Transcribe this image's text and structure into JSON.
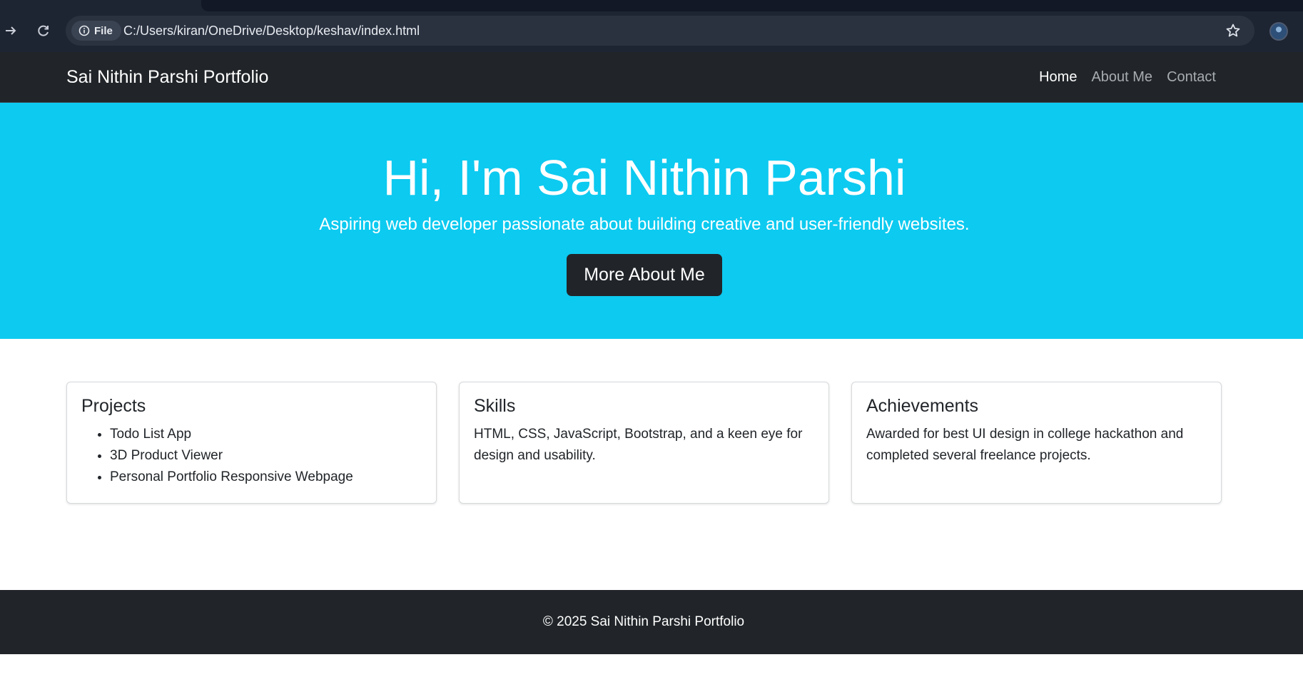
{
  "browser": {
    "file_chip_label": "File",
    "url": "C:/Users/kiran/OneDrive/Desktop/keshav/index.html",
    "icons": [
      "forward-icon",
      "reload-icon",
      "info-icon",
      "bookmark-star-icon",
      "profile-avatar"
    ]
  },
  "navbar": {
    "brand": "Sai Nithin Parshi Portfolio",
    "links": [
      {
        "label": "Home",
        "active": true
      },
      {
        "label": "About Me",
        "active": false
      },
      {
        "label": "Contact",
        "active": false
      }
    ]
  },
  "hero": {
    "title": "Hi, I'm Sai Nithin Parshi",
    "subtitle": "Aspiring web developer passionate about building creative and user-friendly websites.",
    "button_label": "More About Me"
  },
  "cards": [
    {
      "title": "Projects",
      "items": [
        "Todo List App",
        "3D Product Viewer",
        "Personal Portfolio Responsive Webpage"
      ]
    },
    {
      "title": "Skills",
      "text": "HTML, CSS, JavaScript, Bootstrap, and a keen eye for design and usability."
    },
    {
      "title": "Achievements",
      "text": "Awarded for best UI design in college hackathon and completed several freelance projects."
    }
  ],
  "footer": {
    "text": "© 2025 Sai Nithin Parshi Portfolio"
  },
  "colors": {
    "hero_bg": "#0dcaf0",
    "dark": "#212529",
    "nav_inactive": "#a7acb1"
  }
}
